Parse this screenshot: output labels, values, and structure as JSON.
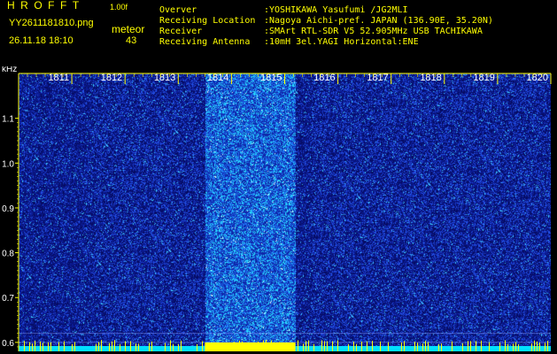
{
  "header": {
    "title": "HROFFT",
    "version": "1.00f",
    "filename": "YY2611181810.png",
    "meteor_label": "meteor",
    "datetime": "26.11.18 18:10",
    "meteor_count": "43"
  },
  "info": [
    {
      "label": "Overver",
      "value": ":YOSHIKAWA Yasufumi /JG2MLI"
    },
    {
      "label": "Receiving Location",
      "value": ":Nagoya Aichi-pref. JAPAN (136.90E, 35.20N)"
    },
    {
      "label": "Receiver",
      "value": ":SMArt RTL-SDR V5 52.905MHz USB TACHIKAWA"
    },
    {
      "label": "Receiving Antenna",
      "value": ":10mH 3el.YAGI Horizontal:ENE"
    }
  ],
  "spectrogram": {
    "y_unit": "kHz",
    "y_ticks": [
      "1.1",
      "1.0",
      "0.9",
      "0.8",
      "0.7",
      "0.6"
    ],
    "y_tick_values": [
      1.1,
      1.0,
      0.9,
      0.8,
      0.7,
      0.6
    ],
    "y_range": [
      0.58,
      1.2
    ],
    "time_ticks": [
      "1811",
      "1812",
      "1813",
      "1814",
      "1815",
      "1816",
      "1817",
      "1818",
      "1819",
      "1820"
    ],
    "time_range": [
      1810,
      1820
    ],
    "bright_interval": [
      1813.5,
      1815.2
    ],
    "colors": {
      "background": "#000000",
      "noise_dark": "#0a1a8a",
      "noise_mid": "#2a4ee0",
      "noise_bright": "#20d0ff",
      "axis": "#ffff00",
      "label": "#ffffff",
      "baseline": "#00e0ff",
      "burst": "#ffff00"
    }
  }
}
